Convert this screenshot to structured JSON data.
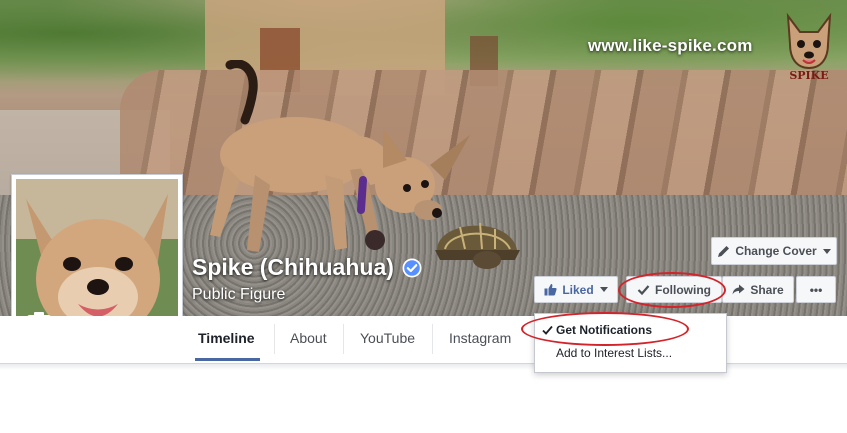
{
  "cover": {
    "site_url": "www.like-spike.com",
    "logo_text": "SPIKE",
    "change_cover_label": "Change Cover"
  },
  "profile": {
    "name": "Spike (Chihuahua)",
    "category": "Public Figure",
    "verified": true
  },
  "actions": {
    "liked_label": "Liked",
    "following_label": "Following",
    "share_label": "Share",
    "more_label": "•••"
  },
  "nav": {
    "tabs": [
      {
        "label": "Timeline",
        "active": true
      },
      {
        "label": "About",
        "active": false
      },
      {
        "label": "YouTube",
        "active": false
      },
      {
        "label": "Instagram",
        "active": false
      }
    ]
  },
  "following_menu": {
    "items": [
      {
        "label": "Get Notifications",
        "checked": true
      },
      {
        "label": "Add to Interest Lists..."
      }
    ]
  },
  "colors": {
    "facebook_blue": "#4b67a1",
    "annotation_red": "#d2242a",
    "verified_blue": "#5890ff",
    "button_bg": "#f6f7f9"
  },
  "icons": [
    "camera-icon",
    "verified-badge-icon",
    "thumbs-up-icon",
    "checkmark-icon",
    "share-arrow-icon",
    "pencil-icon",
    "chevron-down-icon"
  ]
}
